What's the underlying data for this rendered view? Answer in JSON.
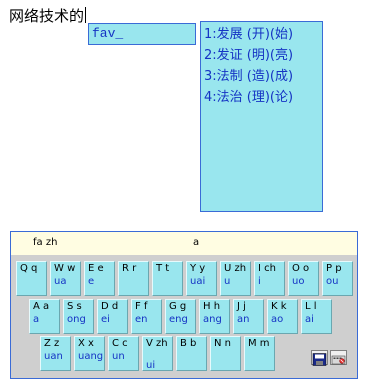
{
  "document": {
    "text": "网络技术的"
  },
  "composition": {
    "text": "fav_"
  },
  "candidates": [
    "1:发展 (开)(始)",
    "2:发证 (明)(亮)",
    "3:法制 (造)(成)",
    "4:法治 (理)(论)"
  ],
  "keyboard": {
    "header_pinyin": "fa zh",
    "header_char": "a",
    "rows": [
      [
        {
          "top": "Q q",
          "bottom": ""
        },
        {
          "top": "W w",
          "bottom": "ua"
        },
        {
          "top": "E e",
          "bottom": "e"
        },
        {
          "top": "R r",
          "bottom": ""
        },
        {
          "top": "T t",
          "bottom": ""
        },
        {
          "top": "Y y",
          "bottom": "uai"
        },
        {
          "top": "U zh",
          "bottom": "u"
        },
        {
          "top": "I ch",
          "bottom": "i"
        },
        {
          "top": "O o",
          "bottom": "uo"
        },
        {
          "top": "P p",
          "bottom": "ou"
        }
      ],
      [
        {
          "top": "A a",
          "bottom": "a"
        },
        {
          "top": "S s",
          "bottom": "ong"
        },
        {
          "top": "D d",
          "bottom": "ei"
        },
        {
          "top": "F f",
          "bottom": "en"
        },
        {
          "top": "G g",
          "bottom": "eng"
        },
        {
          "top": "H h",
          "bottom": "ang"
        },
        {
          "top": "J j",
          "bottom": "an"
        },
        {
          "top": "K k",
          "bottom": "ao"
        },
        {
          "top": "L l",
          "bottom": "ai"
        }
      ],
      [
        {
          "top": "Z z",
          "bottom": "uan"
        },
        {
          "top": "X x",
          "bottom": "uang"
        },
        {
          "top": "C c",
          "bottom": "un"
        },
        {
          "top": "V zh",
          "bottom": "ui"
        },
        {
          "top": "B b",
          "bottom": ""
        },
        {
          "top": "N n",
          "bottom": ""
        },
        {
          "top": "M m",
          "bottom": ""
        }
      ]
    ],
    "save_icon": "floppy-disk-icon",
    "settings_icon": "keyboard-settings-icon"
  }
}
